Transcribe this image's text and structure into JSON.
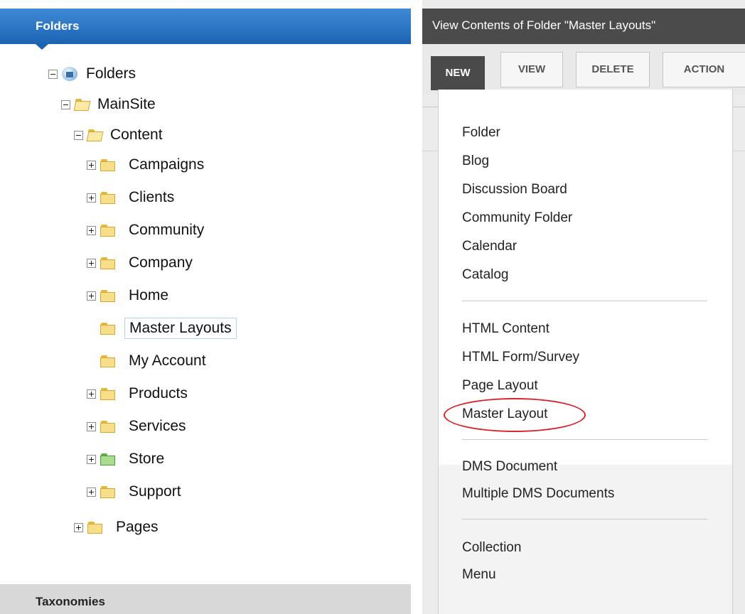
{
  "folders_panel": {
    "header": "Folders",
    "tree": {
      "root": "Folders",
      "site": "MainSite",
      "content": "Content",
      "items": [
        "Campaigns",
        "Clients",
        "Community",
        "Company",
        "Home",
        "Master Layouts",
        "My Account",
        "Products",
        "Services",
        "Store",
        "Support"
      ],
      "pages": "Pages"
    },
    "footer": "Taxonomies"
  },
  "content_panel": {
    "title": "View Contents of Folder \"Master Layouts\"",
    "toolbar": {
      "new": "NEW",
      "view": "VIEW",
      "delete": "DELETE",
      "action": "ACTION"
    },
    "new_menu": {
      "group1": [
        "Folder",
        "Blog",
        "Discussion Board",
        "Community Folder",
        "Calendar",
        "Catalog"
      ],
      "group2": [
        "HTML Content",
        "HTML Form/Survey",
        "Page Layout",
        "Master Layout"
      ],
      "group3": [
        "DMS Document",
        "Multiple DMS Documents"
      ],
      "group4": [
        "Collection",
        "Menu"
      ]
    }
  },
  "colors": {
    "header_blue": "#2a72c2",
    "highlight_circle": "#d9232a",
    "title_bar": "#4b4b4b"
  }
}
